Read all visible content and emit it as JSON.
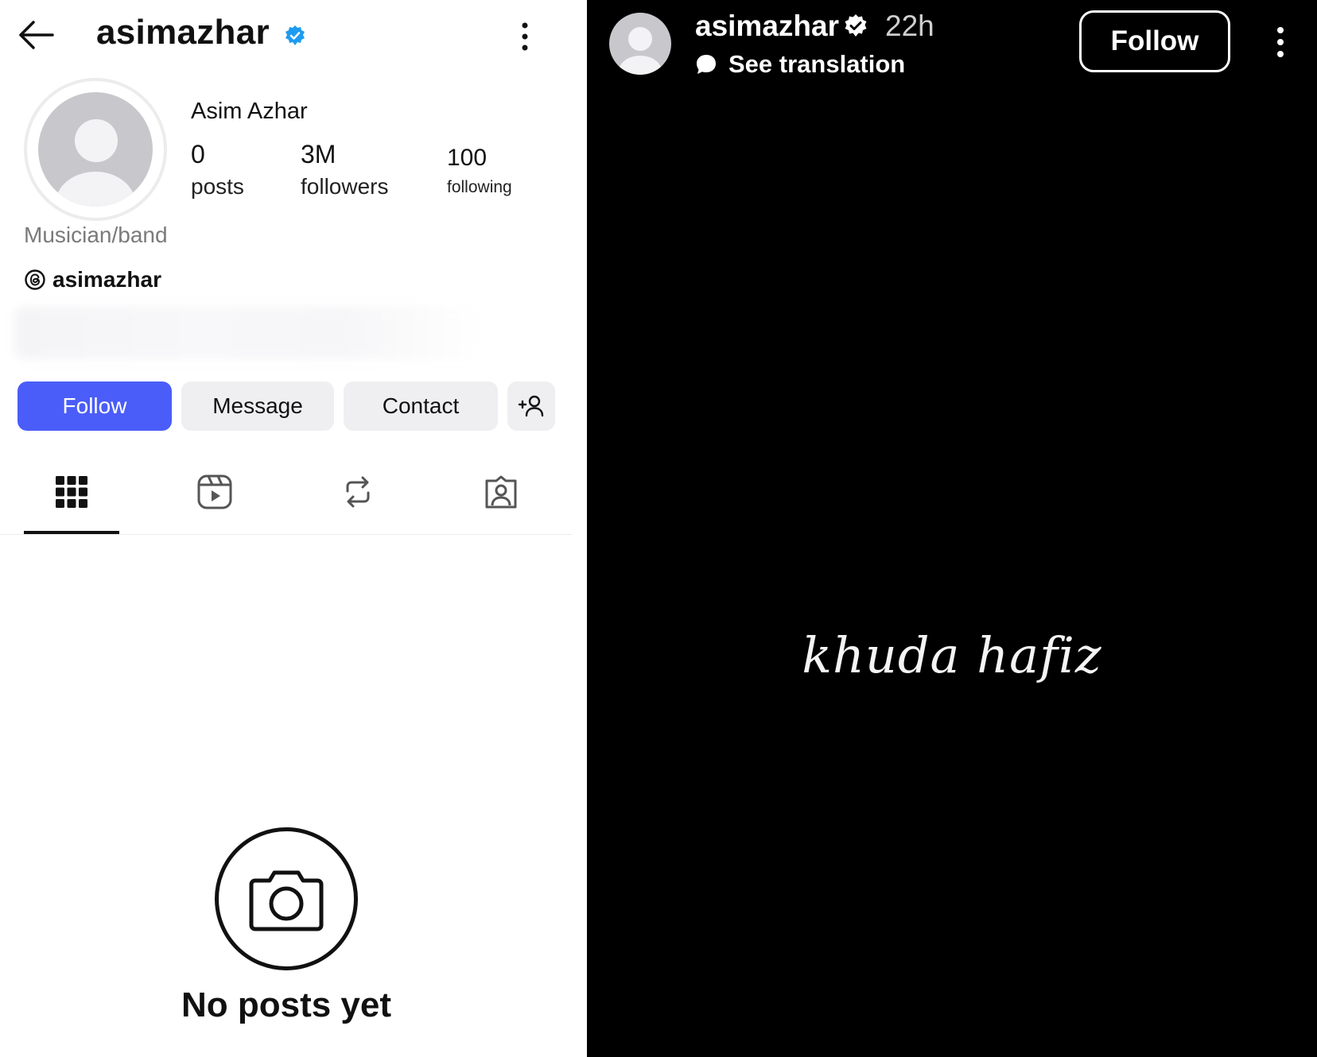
{
  "profile": {
    "handle": "asimazhar",
    "full_name": "Asim Azhar",
    "stats": [
      {
        "value": "0",
        "label": "posts"
      },
      {
        "value": "3M",
        "label": "followers"
      },
      {
        "value": "100",
        "label": "following"
      }
    ],
    "category": "Musician/band",
    "threads_handle": "asimazhar",
    "buttons": {
      "follow": "Follow",
      "message": "Message",
      "contact": "Contact"
    },
    "tabs": [
      "grid-icon",
      "reels-icon",
      "reposts-icon",
      "tagged-icon"
    ],
    "empty_state": "No posts yet"
  },
  "story": {
    "handle": "asimazhar",
    "time": "22h",
    "translation": "See translation",
    "follow": "Follow",
    "text": "khuda hafiz"
  },
  "colors": {
    "follow_blue": "#4a5df9",
    "verified_blue": "#1d9bf0",
    "secondary_button": "#efeff2",
    "story_background": "#000000"
  }
}
